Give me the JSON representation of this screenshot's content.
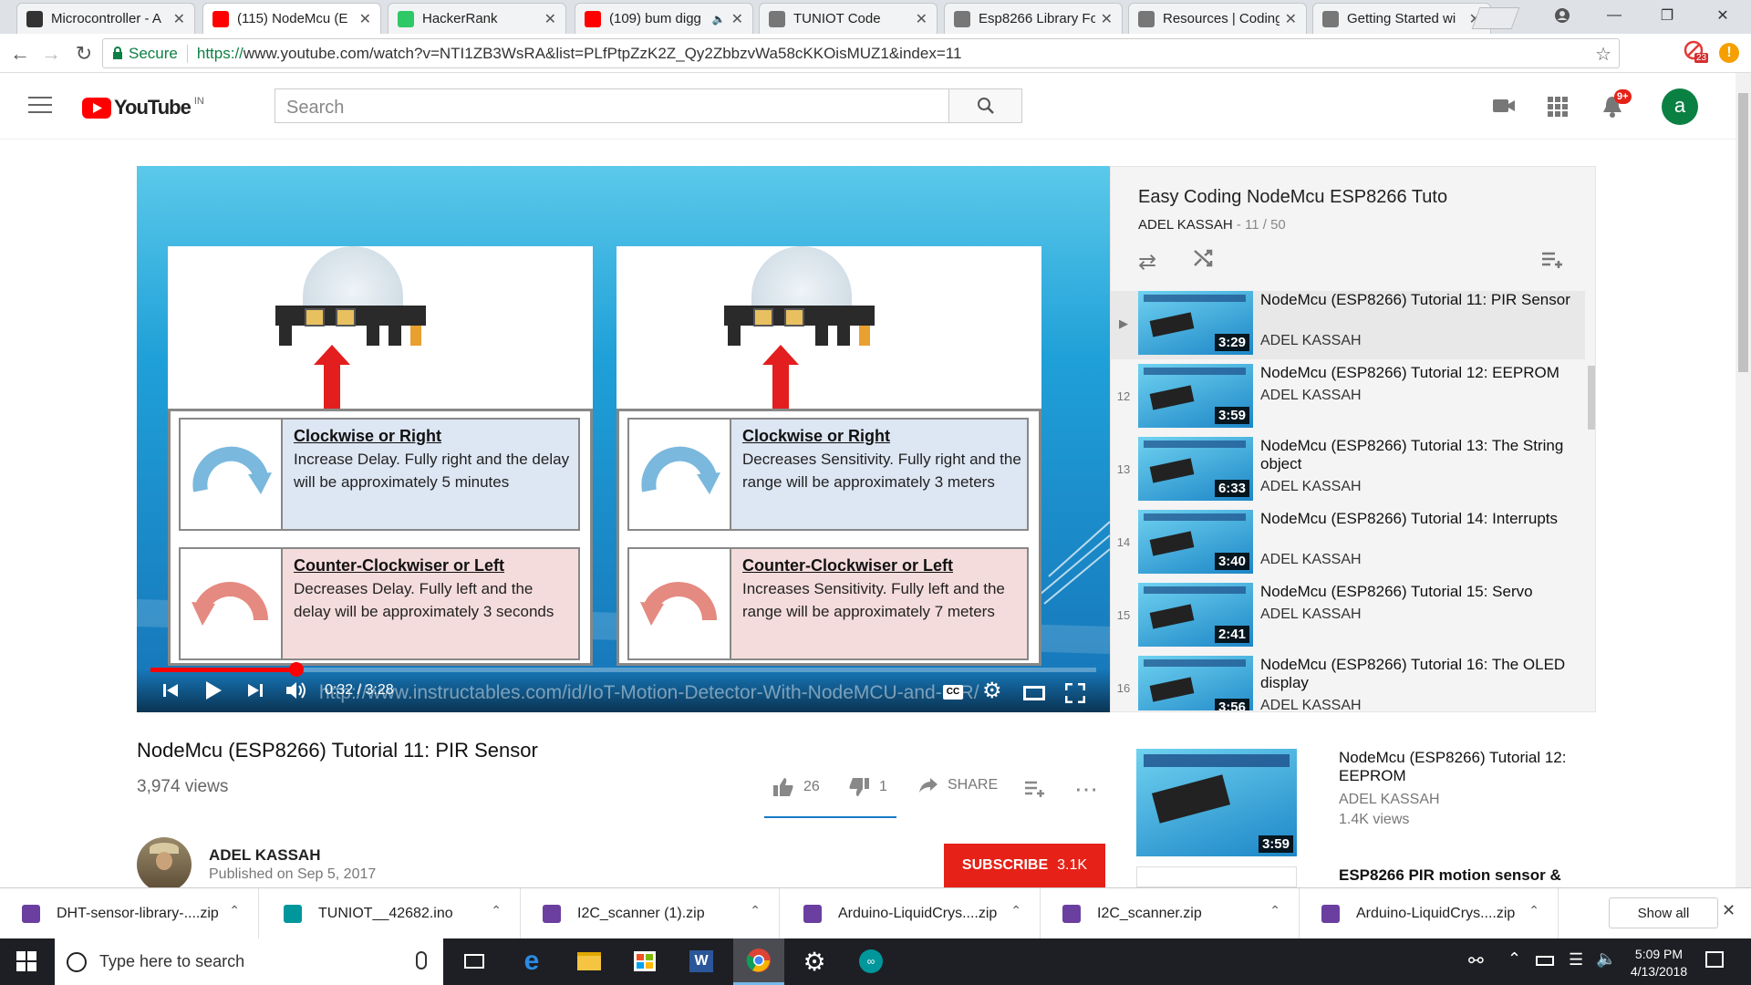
{
  "browser": {
    "tabs": [
      {
        "title": "Microcontroller - A",
        "icon": "instructables-icon",
        "color": "#333333"
      },
      {
        "title": "(115) NodeMcu (E",
        "icon": "youtube-icon",
        "color": "#ff0000"
      },
      {
        "title": "HackerRank",
        "icon": "hackerrank-icon",
        "color": "#2ec866"
      },
      {
        "title": "(109) bum digg",
        "icon": "youtube-icon",
        "color": "#ff0000"
      },
      {
        "title": "TUNIOT Code",
        "icon": "page-icon",
        "color": "#777777"
      },
      {
        "title": "Esp8266 Library Fo",
        "icon": "page-icon",
        "color": "#777777"
      },
      {
        "title": "Resources | Coding",
        "icon": "page-icon",
        "color": "#777777"
      },
      {
        "title": "Getting Started wi",
        "icon": "page-icon",
        "color": "#777777"
      }
    ],
    "secure_label": "Secure",
    "url_scheme": "https://",
    "url_rest": "www.youtube.com/watch?v=NTI1ZB3WsRA&list=PLfPtpZzK2Z_Qy2ZbbzvWa58cKKOisMUZ1&index=11",
    "ext_badge": "23"
  },
  "youtube": {
    "logo_text": "YouTube",
    "logo_region": "IN",
    "search_placeholder": "Search",
    "notif_count": "9+",
    "avatar_letter": "a"
  },
  "player": {
    "time_current": "0:32",
    "time_total": "3:28",
    "time_display": "0:32 / 3:28",
    "progress": 0.154,
    "watermark": "http://www.instructables.com/id/IoT-Motion-Detector-With-NodeMCU-and-PIR/",
    "slides": [
      {
        "cw_title": "Clockwise or Right",
        "cw_text": "Increase Delay.  Fully right and the delay will be approximately 5 minutes",
        "ccw_title": "Counter-Clockwiser or Left",
        "ccw_text": "Decreases Delay.  Fully left and the delay will be approximately 3 seconds"
      },
      {
        "cw_title": "Clockwise or Right",
        "cw_text": "Decreases Sensitivity.  Fully right and the range will be approximately 3 meters",
        "ccw_title": "Counter-Clockwiser or Left",
        "ccw_text": "Increases Sensitivity.  Fully left and the range will be approximately 7 meters"
      }
    ]
  },
  "playlist": {
    "title": "Easy Coding NodeMcu ESP8266 Tuto",
    "channel": "ADEL KASSAH",
    "position": "11 / 50",
    "items": [
      {
        "index": "▶",
        "title": "NodeMcu (ESP8266) Tutorial 11: PIR Sensor",
        "channel": "ADEL KASSAH",
        "duration": "3:29"
      },
      {
        "index": "12",
        "title": "NodeMcu (ESP8266) Tutorial 12: EEPROM",
        "channel": "ADEL KASSAH",
        "duration": "3:59"
      },
      {
        "index": "13",
        "title": "NodeMcu (ESP8266) Tutorial 13: The String object",
        "channel": "ADEL KASSAH",
        "duration": "6:33"
      },
      {
        "index": "14",
        "title": "NodeMcu (ESP8266) Tutorial 14: Interrupts",
        "channel": "ADEL KASSAH",
        "duration": "3:40"
      },
      {
        "index": "15",
        "title": "NodeMcu (ESP8266) Tutorial 15: Servo",
        "channel": "ADEL KASSAH",
        "duration": "2:41"
      },
      {
        "index": "16",
        "title": "NodeMcu (ESP8266) Tutorial 16: The OLED display",
        "channel": "ADEL KASSAH",
        "duration": "3:56"
      }
    ]
  },
  "video": {
    "title": "NodeMcu (ESP8266) Tutorial 11: PIR Sensor",
    "views": "3,974 views",
    "likes": "26",
    "dislikes": "1",
    "share_label": "SHARE",
    "channel": "ADEL KASSAH",
    "published": "Published on Sep 5, 2017",
    "subscribe_label": "SUBSCRIBE",
    "subscribers": "3.1K"
  },
  "related": [
    {
      "title": "NodeMcu (ESP8266) Tutorial 12: EEPROM",
      "channel": "ADEL KASSAH",
      "views": "1.4K views",
      "duration": "3:59"
    },
    {
      "title": "ESP8266 PIR motion sensor &",
      "channel": "",
      "views": "",
      "duration": ""
    }
  ],
  "downloads": {
    "items": [
      {
        "name": "DHT-sensor-library-....zip",
        "icon_color": "#6b3fa0"
      },
      {
        "name": "TUNIOT__42682.ino",
        "icon_color": "#00979c"
      },
      {
        "name": "I2C_scanner (1).zip",
        "icon_color": "#6b3fa0"
      },
      {
        "name": "Arduino-LiquidCrys....zip",
        "icon_color": "#6b3fa0"
      },
      {
        "name": "I2C_scanner.zip",
        "icon_color": "#6b3fa0"
      },
      {
        "name": "Arduino-LiquidCrys....zip",
        "icon_color": "#6b3fa0"
      }
    ],
    "show_all_label": "Show all"
  },
  "taskbar": {
    "search_placeholder": "Type here to search",
    "time": "5:09 PM",
    "date": "4/13/2018"
  }
}
